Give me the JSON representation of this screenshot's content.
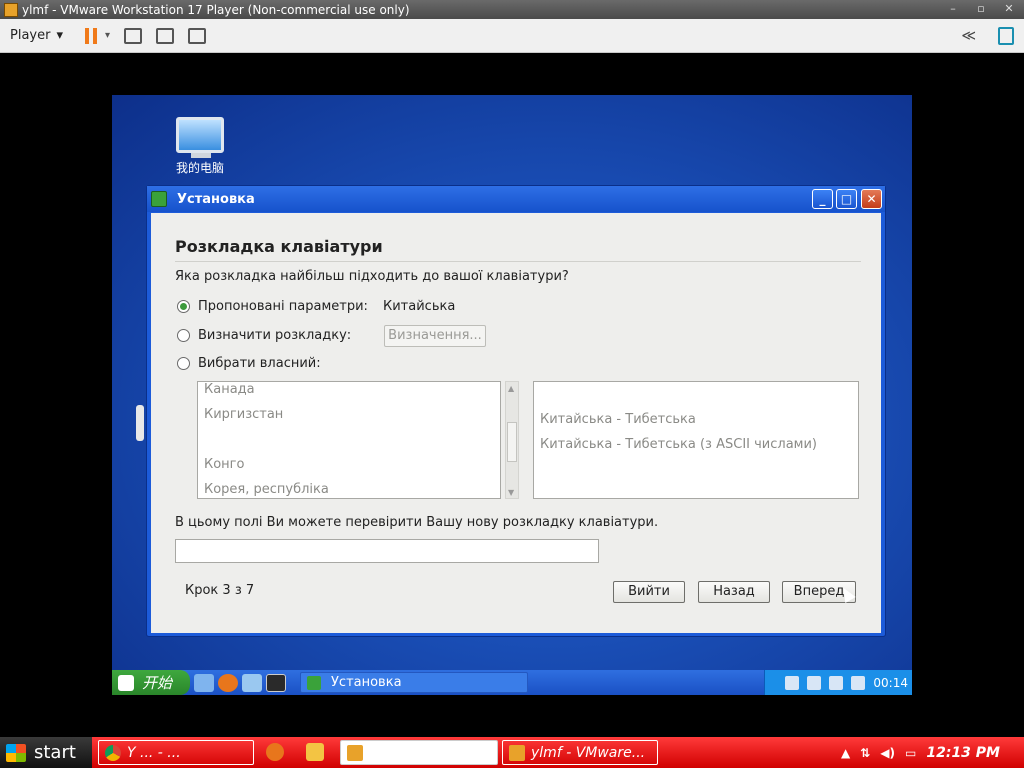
{
  "vmware": {
    "title": "ylmf - VMware Workstation 17 Player (Non-commercial use only)",
    "player_menu": "Player",
    "window_buttons": [
      "–",
      "▫",
      "✕"
    ]
  },
  "guest": {
    "desktop_icon_label": "我的电脑",
    "installer": {
      "window_title": "Установка",
      "heading": "Розкладка клавіатури",
      "question": "Яка розкладка найбільш підходить до вашої клавіатури?",
      "options": [
        {
          "label": "Пропоновані параметри:",
          "checked": true
        },
        {
          "label": "Визначити розкладку:",
          "checked": false
        },
        {
          "label": "Вибрати власний:",
          "checked": false
        }
      ],
      "suggested_value": "Китайська",
      "detect_button": "Визначення...",
      "countries": [
        "Канада",
        "Киргизстан",
        "Конго",
        "Корея, республіка"
      ],
      "variants": [
        "Китайська - Тибетська",
        "Китайська - Тибетська (з ASCII числами)"
      ],
      "test_label": "В цьому полі Ви можете перевірити Вашу нову розкладку клавіатури.",
      "test_value": "",
      "step": "Крок 3 з 7",
      "buttons": {
        "quit": "Вийти",
        "back": "Назад",
        "next": "Вперед"
      }
    },
    "taskbar": {
      "start_label": "开始",
      "task_label": "Установка",
      "clock": "00:14"
    }
  },
  "host_taskbar": {
    "start_label": "start",
    "tasks": [
      {
        "label": "Y ... - ..."
      },
      {
        "label": ""
      },
      {
        "label": "ylmf - VMware..."
      }
    ],
    "clock": "12:13 PM"
  },
  "colors": {
    "accent_blue": "#1c5bd9",
    "host_taskbar_red": "#e00000",
    "pause_orange": "#f07a1a",
    "radio_green": "#3d9a3d"
  }
}
